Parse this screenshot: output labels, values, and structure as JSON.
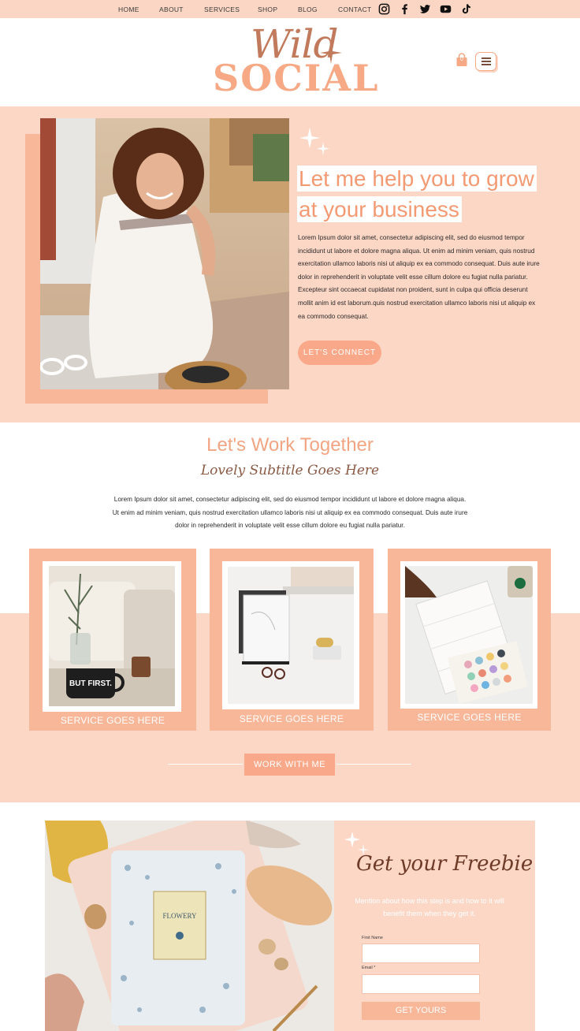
{
  "nav": {
    "items": [
      "HOME",
      "ABOUT",
      "SERVICES",
      "SHOP",
      "BLOG",
      "CONTACT"
    ],
    "social_icons": [
      "instagram-icon",
      "facebook-icon",
      "twitter-icon",
      "youtube-icon",
      "tiktok-icon"
    ]
  },
  "brand": {
    "script": "Wild",
    "block": "SOCIAL",
    "cart_count": "0",
    "colors": {
      "peach": "#fdd7c6",
      "coral": "#f9b799",
      "accent": "#f39a73",
      "brown": "#8a5a45"
    }
  },
  "hero": {
    "heading_line1": "Let me help you to grow",
    "heading_line2": "at your business",
    "body": "Lorem Ipsum dolor sit amet, consectetur adipiscing elit, sed do eiusmod tempor incididunt ut labore et dolore magna aliqua. Ut enim ad minim veniam, quis nostrud exercitation ullamco laboris nisi ut aliquip ex ea commodo consequat. Duis aute irure dolor in reprehenderit in voluptate velit esse cillum dolore eu fugiat nulla pariatur. Excepteur sint occaecat cupidatat non proident, sunt in culpa qui officia deserunt mollit anim id est laborum.quis nostrud exercitation ullamco laboris nisi ut aliquip ex ea commodo consequat.",
    "cta": "LET'S CONNECT"
  },
  "work": {
    "title": "Let's Work Together",
    "subtitle": "Lovely Subtitle Goes Here",
    "body_line1": "Lorem Ipsum dolor sit amet, consectetur adipiscing elit, sed do eiusmod tempor incididunt ut labore et dolore magna aliqua.",
    "body_line2": "Ut enim ad minim veniam, quis nostrud exercitation ullamco laboris nisi ut aliquip ex ea commodo consequat. Duis aute irure",
    "body_line3": "dolor in reprehenderit in voluptate velit esse cillum dolore eu fugiat nulla pariatur.",
    "services": [
      "SERVICE GOES HERE",
      "SERVICE GOES HERE",
      "SERVICE GOES HERE"
    ],
    "mug_text": "BUT FIRST.",
    "cta": "WORK WITH ME"
  },
  "freebie": {
    "title": "Get your Freebie",
    "description": "Mention about how this step is and how to it will benefit them when they get it.",
    "first_name_label": "First Name",
    "email_label": "Email *",
    "submit": "GET YOURS",
    "notebook_brand": "FLOWERY"
  }
}
